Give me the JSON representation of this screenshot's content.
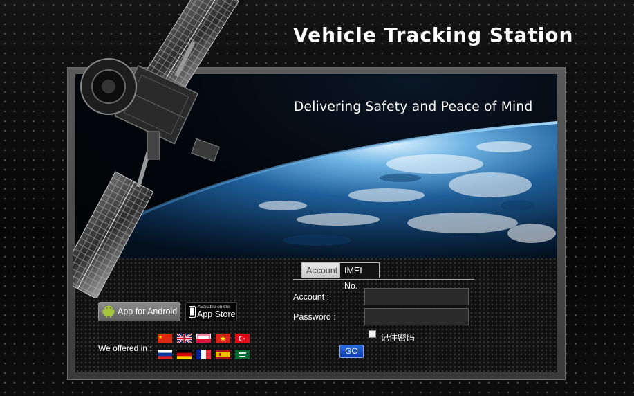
{
  "header": {
    "title": "Vehicle Tracking Station"
  },
  "banner": {
    "tagline": "Delivering Safety and Peace of Mind"
  },
  "login": {
    "tabs": [
      {
        "label": "Account",
        "active": true
      },
      {
        "label": "IMEI No.",
        "active": false
      }
    ],
    "account_label": "Account :",
    "account_value": "",
    "password_label": "Password :",
    "password_value": "",
    "remember_label": "记住密码",
    "remember_checked": false,
    "go_label": "GO"
  },
  "apps": {
    "android_label": "App for Android",
    "appstore_small": "Available on the",
    "appstore_label": "App Store"
  },
  "languages": {
    "label": "We offered in :",
    "flags": [
      "china-flag",
      "uk-flag",
      "poland-flag",
      "vietnam-flag",
      "turkey-flag",
      "russia-flag",
      "germany-flag",
      "france-flag",
      "spain-flag",
      "saudi-arabia-flag"
    ]
  },
  "colors": {
    "page_bg": "#0c0c0c",
    "frame": "#4a4a4a",
    "go_button": "#1e54cc"
  }
}
